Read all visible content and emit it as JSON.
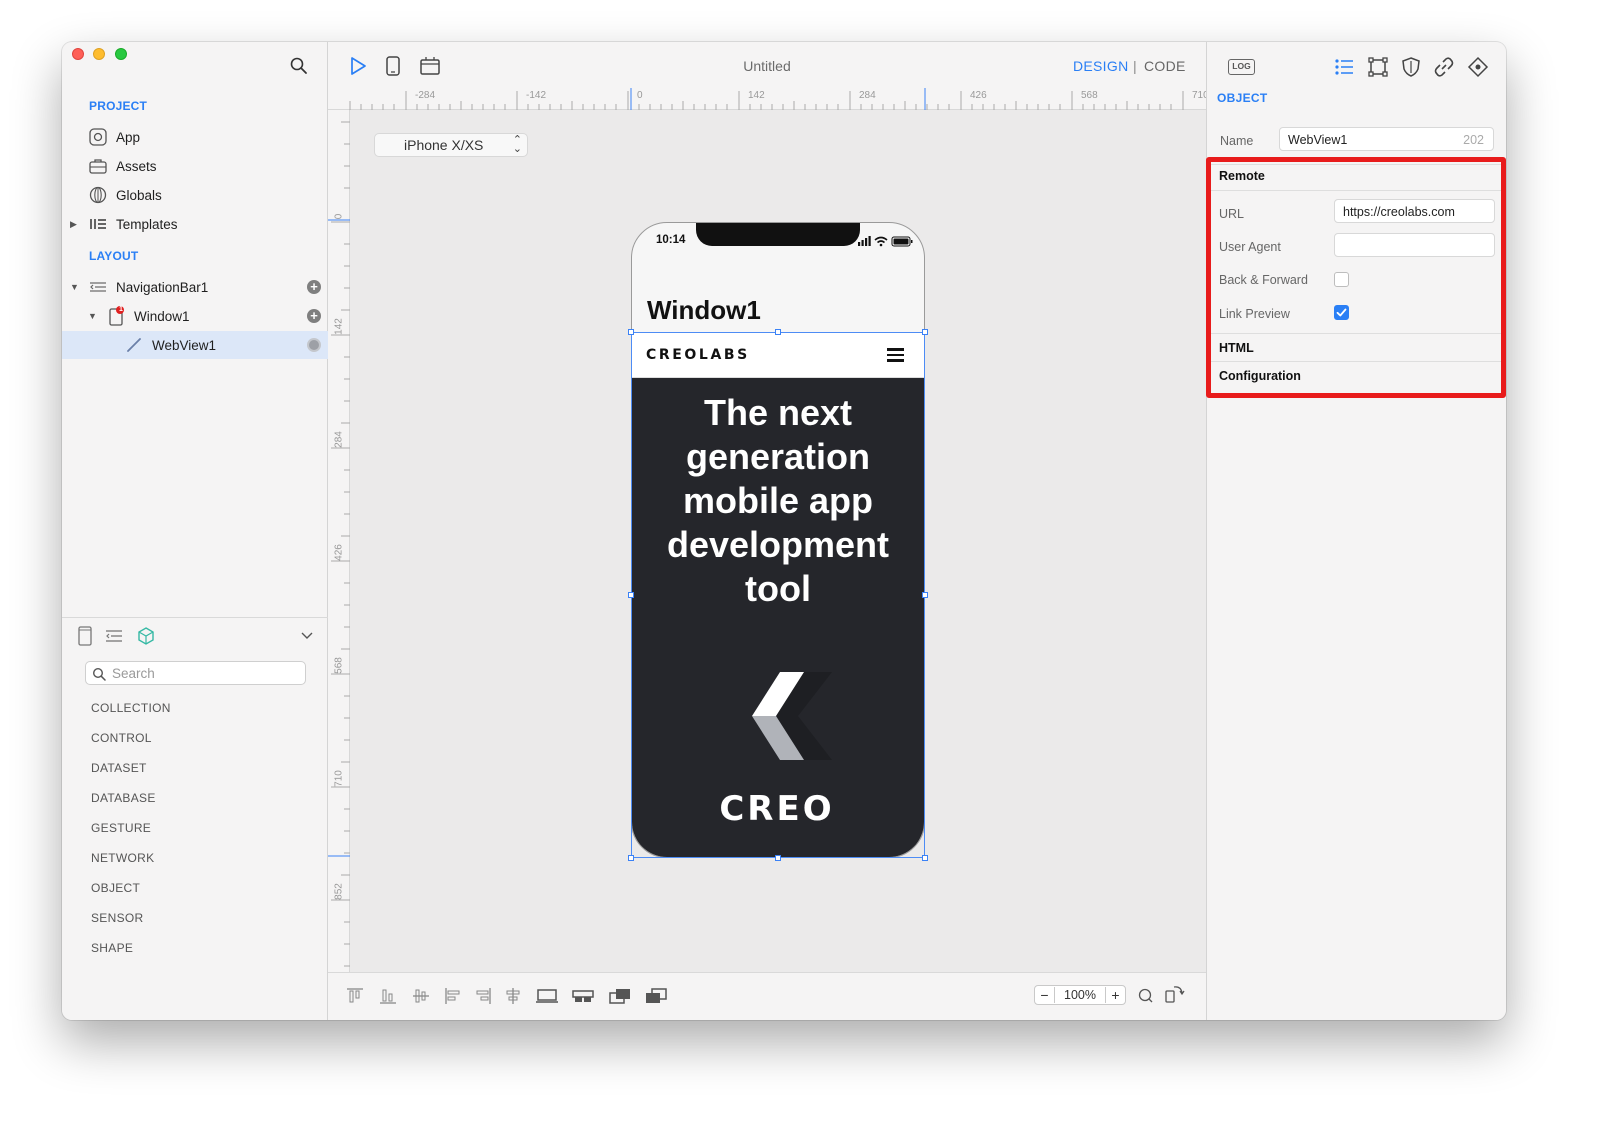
{
  "window": {
    "title": "Untitled"
  },
  "sidebar": {
    "project_title": "PROJECT",
    "project_items": [
      {
        "label": "App",
        "icon": "app-icon"
      },
      {
        "label": "Assets",
        "icon": "briefcase-icon"
      },
      {
        "label": "Globals",
        "icon": "globe-icon"
      },
      {
        "label": "Templates",
        "icon": "templates-icon"
      }
    ],
    "layout_title": "LAYOUT",
    "layout_items": [
      {
        "label": "NavigationBar1",
        "icon": "navigation-bar-icon"
      },
      {
        "label": "Window1",
        "icon": "window-icon",
        "badge": "1"
      },
      {
        "label": "WebView1",
        "icon": "webview-icon"
      }
    ],
    "library": {
      "search_placeholder": "Search",
      "categories": [
        "COLLECTION",
        "CONTROL",
        "DATASET",
        "DATABASE",
        "GESTURE",
        "NETWORK",
        "OBJECT",
        "SENSOR",
        "SHAPE"
      ]
    }
  },
  "toolbar": {
    "mode_design": "DESIGN",
    "mode_separator": "|",
    "mode_code": "CODE",
    "device": "iPhone X/XS"
  },
  "ruler": {
    "top_labels": [
      "-284",
      "-142",
      "0",
      "142",
      "284",
      "426",
      "568",
      "710"
    ],
    "left_labels": [
      "0",
      "142",
      "284",
      "426",
      "568",
      "710",
      "852"
    ]
  },
  "phone": {
    "time": "10:14",
    "window_title": "Window1",
    "web_logo": "CREOLABS",
    "headline": "The next generation mobile app development tool",
    "footer_word": "CREO"
  },
  "zoom": {
    "minus": "−",
    "value": "100%",
    "plus": "+"
  },
  "inspector": {
    "log_label": "LOG",
    "object_title": "OBJECT",
    "name_label": "Name",
    "name_value": "WebView1",
    "name_id": "202",
    "remote_title": "Remote",
    "url_label": "URL",
    "url_value": "https://creolabs.com",
    "user_agent_label": "User Agent",
    "user_agent_value": "",
    "back_forward_label": "Back & Forward",
    "back_forward_checked": false,
    "link_preview_label": "Link Preview",
    "link_preview_checked": true,
    "html_title": "HTML",
    "configuration_title": "Configuration"
  },
  "colors": {
    "accent": "#2a7ff5",
    "highlight": "#e81b1b",
    "webview_bg": "#25262b"
  }
}
